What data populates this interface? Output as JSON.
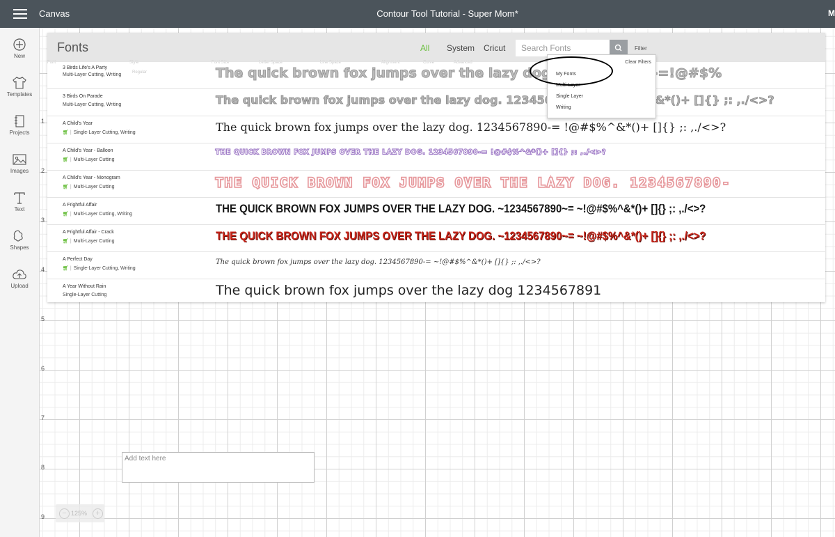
{
  "topbar": {
    "app_name": "Canvas",
    "doc_title": "Contour Tool Tutorial - Super Mom*",
    "right_label": "M"
  },
  "sidebar": {
    "items": [
      {
        "label": "New",
        "icon": "plus-icon"
      },
      {
        "label": "Templates",
        "icon": "shirt-icon"
      },
      {
        "label": "Projects",
        "icon": "notebook-icon"
      },
      {
        "label": "Images",
        "icon": "image-icon"
      },
      {
        "label": "Text",
        "icon": "text-icon"
      },
      {
        "label": "Shapes",
        "icon": "shapes-icon"
      },
      {
        "label": "Upload",
        "icon": "cloud-upload-icon"
      }
    ]
  },
  "canvas": {
    "ruler_left": [
      "1",
      "2",
      "3",
      "4",
      "5",
      "6",
      "7",
      "8",
      "9"
    ],
    "add_text_placeholder": "Add text here",
    "zoom_level": "125%"
  },
  "fonts_panel": {
    "title": "Fonts",
    "tabs": [
      "All",
      "System",
      "Cricut"
    ],
    "search_placeholder": "Search Fonts",
    "filter_label": "Filter",
    "ghost_toolbar": [
      "Font",
      "Style",
      "Font Size",
      "Letter Space",
      "Line Space",
      "Alignment",
      "Curve",
      "Advanced",
      "Regular"
    ],
    "fonts": [
      {
        "name": "3 Birds Life's A Party",
        "type": "Multi-Layer Cutting, Writing",
        "cart": false,
        "sample": "The quick brown fox jumps over the lazy dog. 1234567890-=!@#$%",
        "color": "#bdbdbd"
      },
      {
        "name": "3 Birds On Parade",
        "type": "Multi-Layer Cutting, Writing",
        "cart": false,
        "sample": "The quick brown fox jumps over the lazy dog. 1234567890-= !@#$%^&*()+ []{} ;: ,./<>?",
        "color": "#b5b5b5"
      },
      {
        "name": "A Child's Year",
        "type": "Single-Layer Cutting, Writing",
        "cart": true,
        "sample": "The quick brown fox jumps over the lazy dog. 1234567890-= !@#$%^&*()+ []{} ;: ,./<>?",
        "color": "#222222"
      },
      {
        "name": "A Child's Year - Balloon",
        "type": "Multi-Layer Cutting",
        "cart": true,
        "sample": "THE QUICK BROWN FOX JUMPS OVER THE LAZY DOG. 1234567890-= !@#$%^&*()+ []{} ;: ,./<>?",
        "color": "#a07cc7"
      },
      {
        "name": "A Child's Year - Monogram",
        "type": "Multi-Layer Cutting",
        "cart": true,
        "sample": "THE QUICK BROWN FOX JUMPS OVER THE LAZY DOG. 1234567890-",
        "color": "#e79a9e"
      },
      {
        "name": "A Frightful Affair",
        "type": "Multi-Layer Cutting, Writing",
        "cart": true,
        "sample": "THE QUICK BROWN FOX JUMPS OVER THE LAZY DOG. ~1234567890~= ~!@#$%^&*()+ []{} ;: ,./<>?",
        "color": "#151515"
      },
      {
        "name": "A Frightful Affair - Crack",
        "type": "Multi-Layer Cutting",
        "cart": true,
        "sample": "THE QUICK BROWN FOX JUMPS OVER THE LAZY DOG. ~1234567890~= ~!@#$%^&*()+ []{} ;: ,./<>?",
        "color": "#c8261b"
      },
      {
        "name": "A Perfect Day",
        "type": "Single-Layer Cutting, Writing",
        "cart": true,
        "sample": "The quick brown fox jumps over the lazy dog. 1234567890-= ~!@#$%^&*()+ []{} ;: ,./<>?",
        "color": "#333333"
      },
      {
        "name": "A Year Without Rain",
        "type": "Single-Layer Cutting",
        "cart": false,
        "sample": "The quick brown fox jumps over the lazy dog 1234567891",
        "color": "#222222"
      }
    ]
  },
  "filter_menu": {
    "clear_label": "Clear Filters",
    "options": [
      "My Fonts",
      "Multi-Layer",
      "Single Layer",
      "Writing"
    ]
  },
  "colors": {
    "accent_green": "#6abf3e",
    "topbar": "#4b545b"
  }
}
